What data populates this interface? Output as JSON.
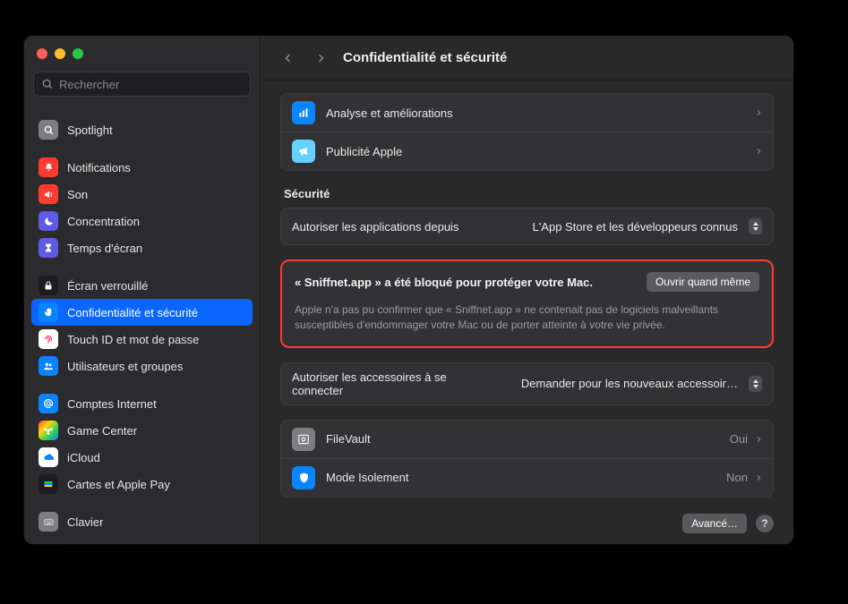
{
  "header": {
    "title": "Confidentialité et sécurité"
  },
  "search": {
    "placeholder": "Rechercher"
  },
  "sidebar": {
    "groups": [
      {
        "items": [
          {
            "label": "Spotlight",
            "icon": "search-icon",
            "bg": "bg-grey"
          }
        ]
      },
      {
        "items": [
          {
            "label": "Notifications",
            "icon": "bell-icon",
            "bg": "bg-red"
          },
          {
            "label": "Son",
            "icon": "speaker-icon",
            "bg": "bg-red"
          },
          {
            "label": "Concentration",
            "icon": "moon-icon",
            "bg": "bg-purple"
          },
          {
            "label": "Temps d'écran",
            "icon": "hourglass-icon",
            "bg": "bg-purple"
          }
        ]
      },
      {
        "items": [
          {
            "label": "Écran verrouillé",
            "icon": "lock-icon",
            "bg": "bg-dark"
          },
          {
            "label": "Confidentialité et sécurité",
            "icon": "hand-icon",
            "bg": "bg-blue",
            "selected": true
          },
          {
            "label": "Touch ID et mot de passe",
            "icon": "fingerprint-icon",
            "bg": "bg-white"
          },
          {
            "label": "Utilisateurs et groupes",
            "icon": "people-icon",
            "bg": "bg-blue"
          }
        ]
      },
      {
        "items": [
          {
            "label": "Comptes Internet",
            "icon": "at-icon",
            "bg": "bg-blue"
          },
          {
            "label": "Game Center",
            "icon": "game-icon",
            "bg": "bg-grad"
          },
          {
            "label": "iCloud",
            "icon": "cloud-icon",
            "bg": "bg-white"
          },
          {
            "label": "Cartes et Apple Pay",
            "icon": "wallet-icon",
            "bg": "bg-dark"
          }
        ]
      },
      {
        "items": [
          {
            "label": "Clavier",
            "icon": "keyboard-icon",
            "bg": "bg-grey"
          }
        ]
      }
    ]
  },
  "content": {
    "top_rows": [
      {
        "label": "Analyse et améliorations",
        "icon": "chart-icon",
        "bg": "bg-blue"
      },
      {
        "label": "Publicité Apple",
        "icon": "megaphone-icon",
        "bg": "bg-lblue"
      }
    ],
    "security_heading": "Sécurité",
    "allow_apps": {
      "title": "Autoriser les applications depuis",
      "value": "L'App Store et les développeurs connus"
    },
    "alert": {
      "message": "« Sniffnet.app » a été bloqué pour protéger votre Mac.",
      "button": "Ouvrir quand même",
      "description": "Apple n'a pas pu confirmer que « Sniffnet.app » ne contenait pas de logiciels malveillants susceptibles d'endommager votre Mac ou de porter atteinte à votre vie privée."
    },
    "allow_accessories": {
      "title": "Autoriser les accessoires à se connecter",
      "value": "Demander pour les nouveaux accessoir…"
    },
    "security_rows": [
      {
        "label": "FileVault",
        "icon": "vault-icon",
        "bg": "bg-grey",
        "value": "Oui"
      },
      {
        "label": "Mode Isolement",
        "icon": "shield-icon",
        "bg": "bg-blue",
        "value": "Non"
      }
    ],
    "advanced_button": "Avancé…",
    "help_label": "?"
  }
}
